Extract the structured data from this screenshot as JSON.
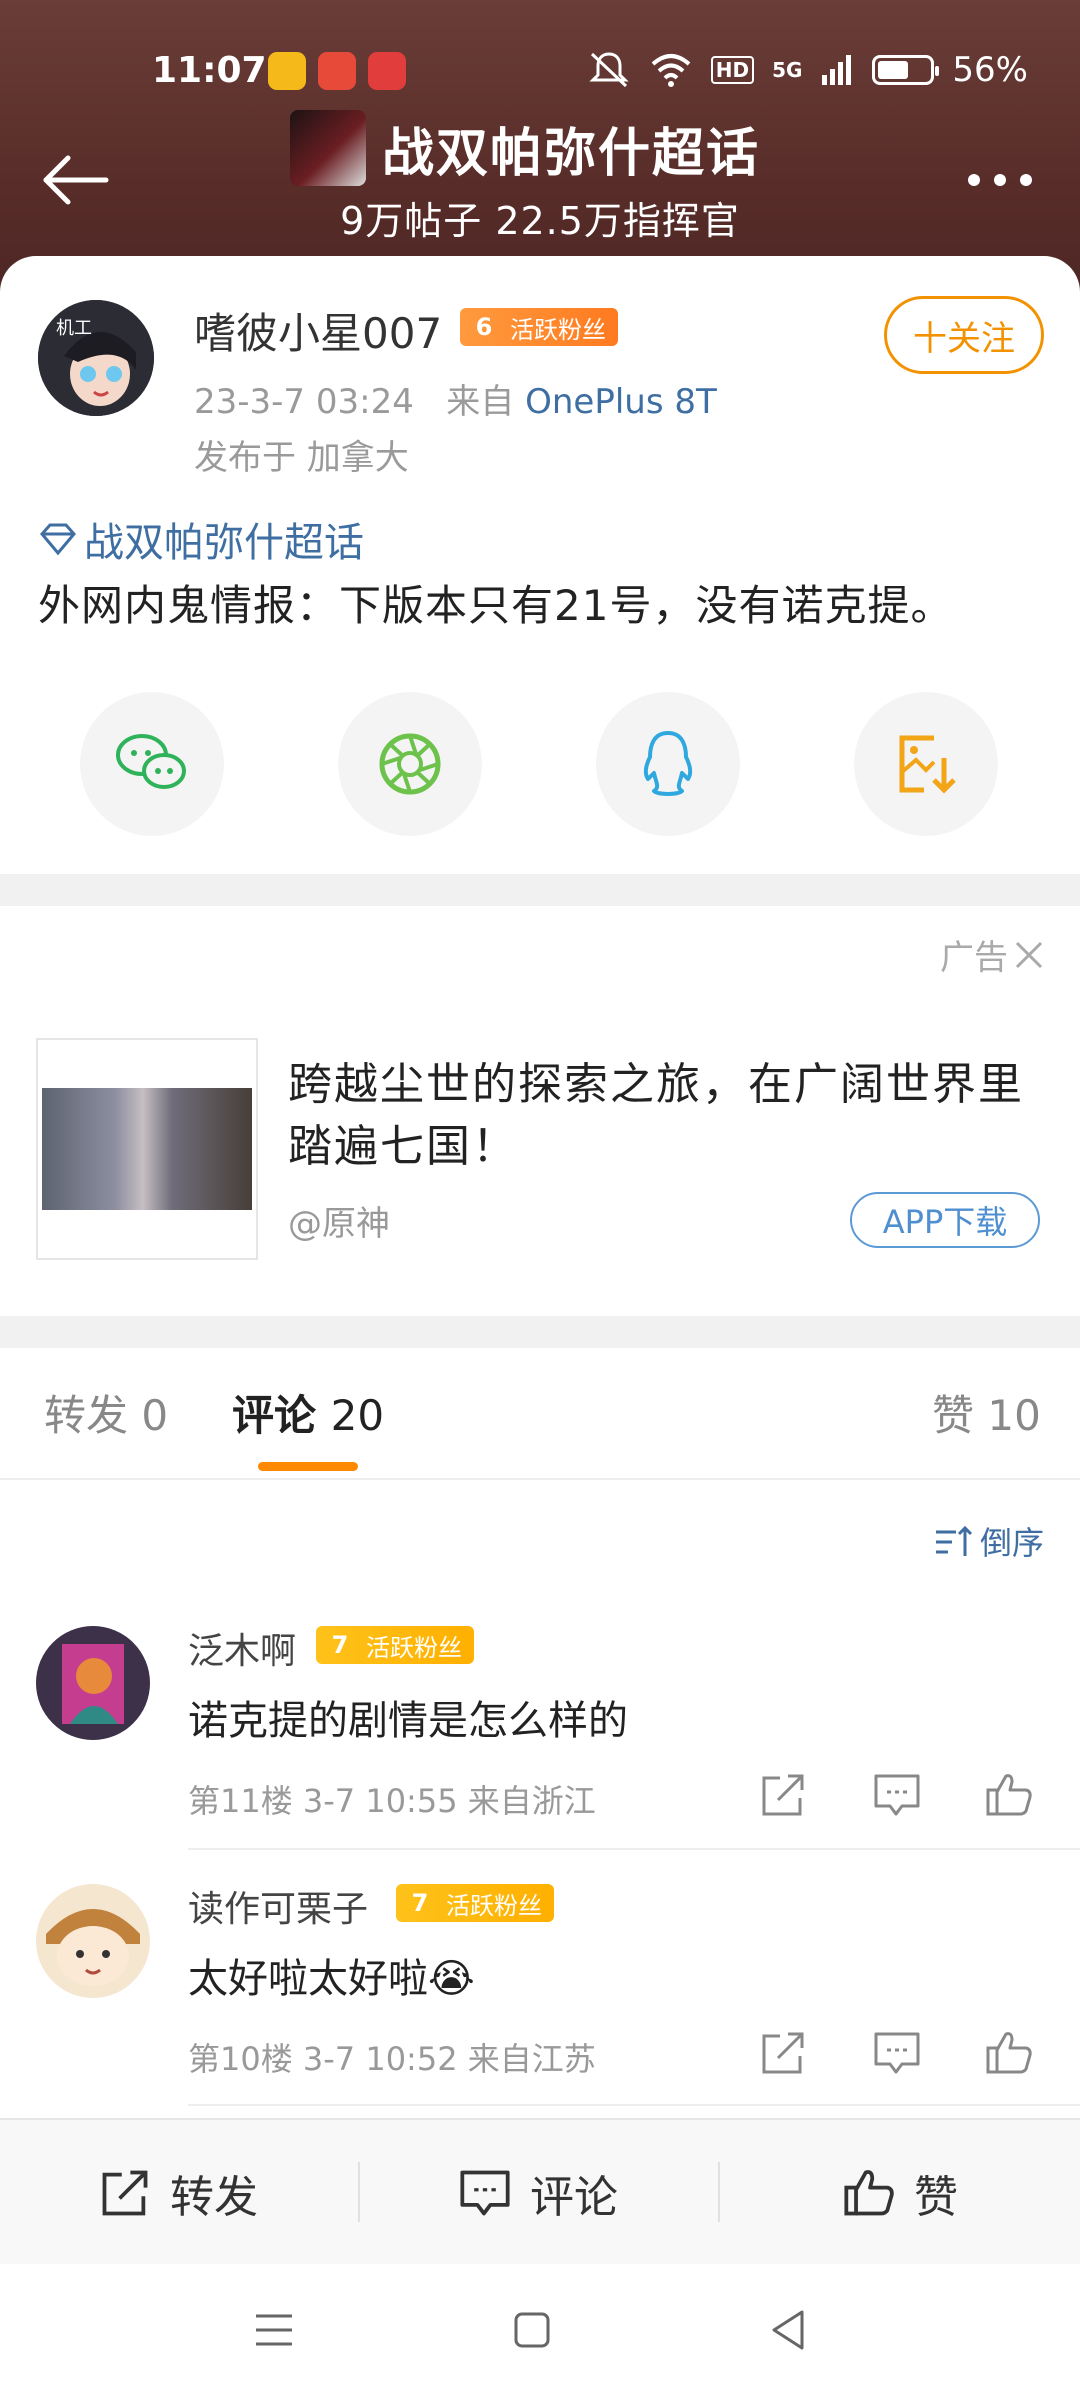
{
  "status_bar": {
    "time": "11:07",
    "battery": "56%",
    "network": "5G",
    "hd": "HD"
  },
  "nav": {
    "title": "战双帕弥什超话",
    "subtitle": "9万帖子 22.5万指挥官"
  },
  "post": {
    "author": "嗜彼小星007",
    "badge_level": "6",
    "badge_text": "活跃粉丝",
    "follow_label": "十关注",
    "time": "23-3-7 03:24",
    "from_prefix": "来自",
    "device": "OnePlus 8T",
    "location": "发布于 加拿大",
    "topic": "战双帕弥什超话",
    "text": "外网内鬼情报：下版本只有21号，没有诺克提。"
  },
  "share_icons": [
    "wechat-icon",
    "moments-icon",
    "qq-icon",
    "save-image-icon"
  ],
  "ad": {
    "label": "广告",
    "title": "跨越尘世的探索之旅，在广阔世界里踏遍七国！",
    "source": "@原神",
    "button": "APP下载"
  },
  "tabs": {
    "repost": "转发",
    "repost_count": "0",
    "comment": "评论",
    "comment_count": "20",
    "like": "赞",
    "like_count": "10",
    "active": "comment"
  },
  "sort_label": "倒序",
  "comments": [
    {
      "name": "泛木啊",
      "badge_level": "7",
      "badge_text": "活跃粉丝",
      "text": "诺克提的剧情是怎么样的",
      "meta": "第11楼 3-7 10:55 来自浙江"
    },
    {
      "name": "读作可栗子",
      "badge_level": "7",
      "badge_text": "活跃粉丝",
      "text": "太好啦太好啦",
      "emoji": "😭",
      "meta": "第10楼 3-7 10:52 来自江苏"
    }
  ],
  "bottom_bar": {
    "repost": "转发",
    "comment": "评论",
    "like": "赞"
  },
  "colors": {
    "header": "#5a2e2a",
    "accent": "#f39200",
    "link": "#3f6ea3",
    "tab_indicator": "#ff8a00"
  }
}
